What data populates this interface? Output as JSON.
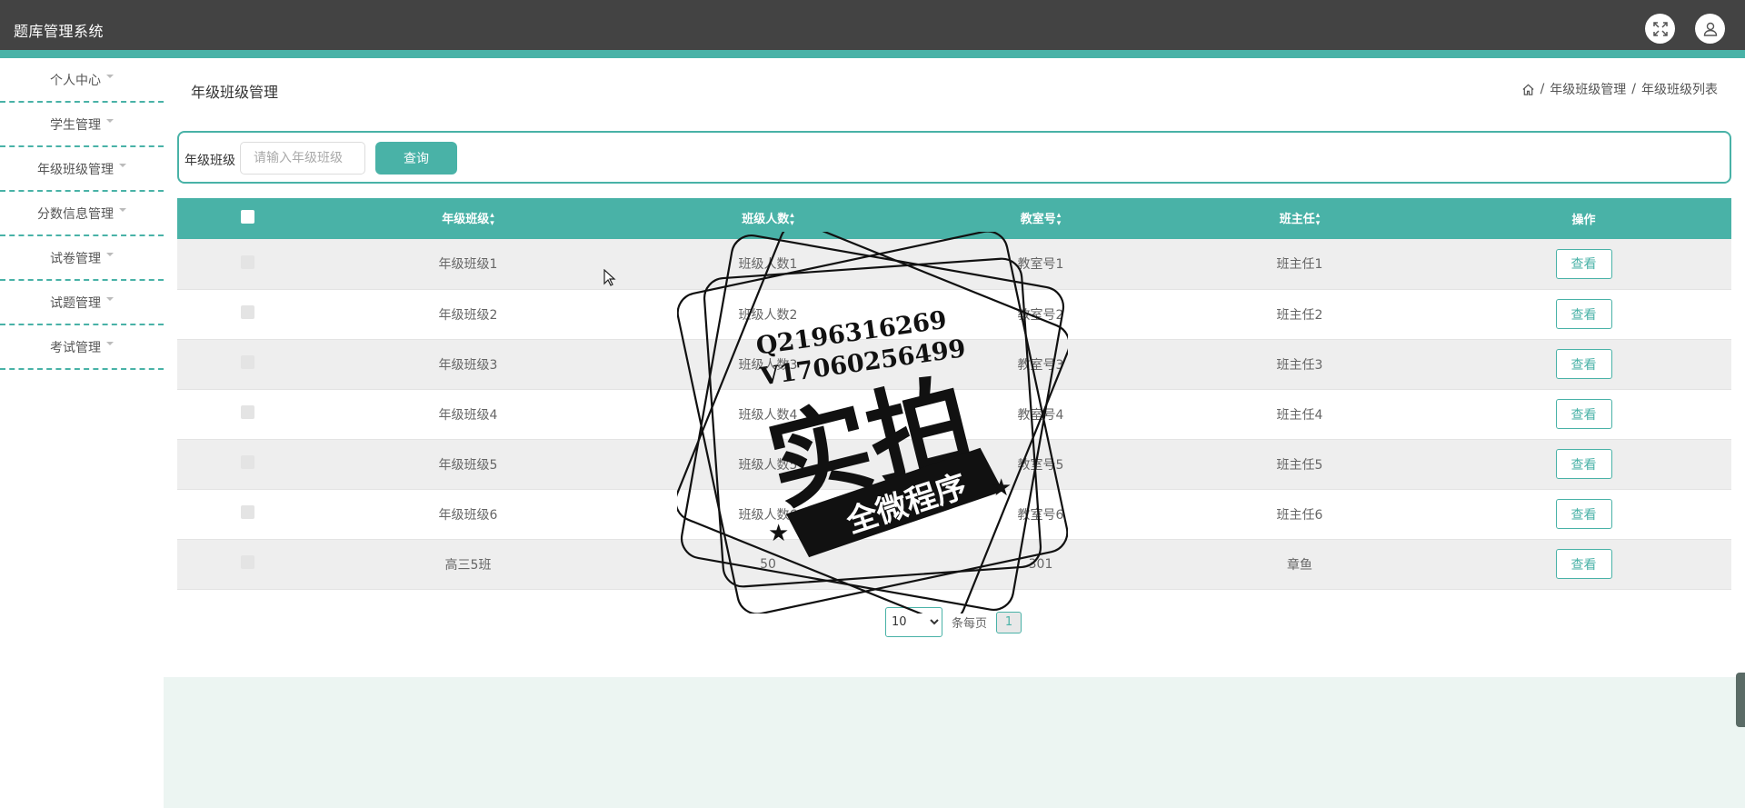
{
  "app": {
    "title": "题库管理系统"
  },
  "header": {
    "icons": [
      "fullscreen-icon",
      "user-icon"
    ]
  },
  "sidebar": {
    "items": [
      {
        "label": "个人中心"
      },
      {
        "label": "学生管理"
      },
      {
        "label": "年级班级管理"
      },
      {
        "label": "分数信息管理"
      },
      {
        "label": "试卷管理"
      },
      {
        "label": "试题管理"
      },
      {
        "label": "考试管理"
      }
    ]
  },
  "page": {
    "title": "年级班级管理"
  },
  "breadcrumb": {
    "items": [
      "年级班级管理",
      "年级班级列表"
    ],
    "separator": "/"
  },
  "search": {
    "label": "年级班级",
    "placeholder": "请输入年级班级",
    "button": "查询"
  },
  "table": {
    "headers": [
      "年级班级",
      "班级人数",
      "教室号",
      "班主任",
      "操作"
    ],
    "rows": [
      {
        "cells": [
          "年级班级1",
          "班级人数1",
          "教室号1",
          "班主任1"
        ],
        "action": "查看"
      },
      {
        "cells": [
          "年级班级2",
          "班级人数2",
          "教室号2",
          "班主任2"
        ],
        "action": "查看"
      },
      {
        "cells": [
          "年级班级3",
          "班级人数3",
          "教室号3",
          "班主任3"
        ],
        "action": "查看"
      },
      {
        "cells": [
          "年级班级4",
          "班级人数4",
          "教室号4",
          "班主任4"
        ],
        "action": "查看"
      },
      {
        "cells": [
          "年级班级5",
          "班级人数5",
          "教室号5",
          "班主任5"
        ],
        "action": "查看"
      },
      {
        "cells": [
          "年级班级6",
          "班级人数6",
          "教室号6",
          "班主任6"
        ],
        "action": "查看"
      },
      {
        "cells": [
          "高三5班",
          "50",
          "301",
          "章鱼"
        ],
        "action": "查看"
      }
    ]
  },
  "pagination": {
    "page_size": "10",
    "page_size_options": [
      "10"
    ],
    "per_page_text": "条每页",
    "current_page": "1"
  },
  "watermark": {
    "line1": "Q2196316269",
    "line2": "V17060256499",
    "main": "实拍",
    "banner": "全微程序"
  },
  "colors": {
    "accent": "#49b2a7",
    "topbar": "#434343",
    "footer": "#ecf5f2"
  }
}
